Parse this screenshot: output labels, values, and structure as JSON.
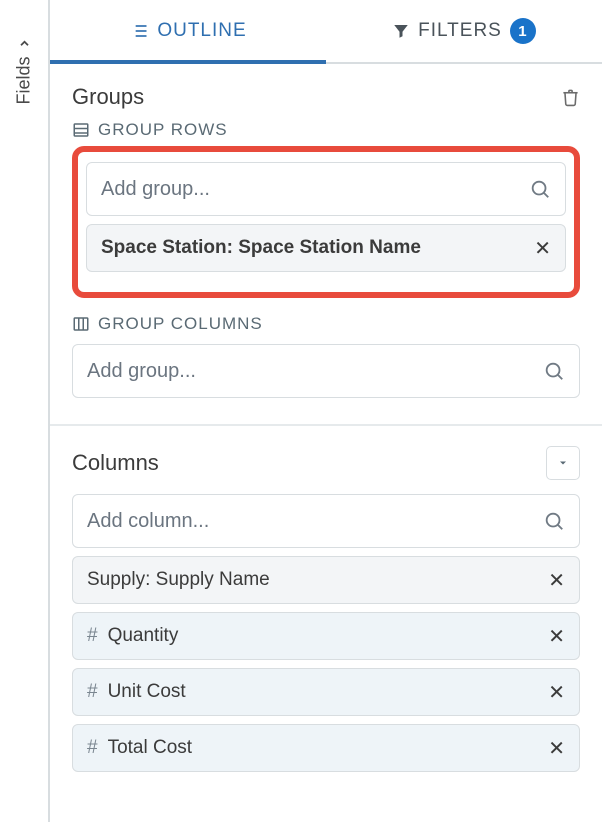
{
  "fields_tab_label": "Fields",
  "tabs": {
    "outline": "OUTLINE",
    "filters": "FILTERS",
    "filters_count": "1"
  },
  "groups": {
    "title": "Groups",
    "rows_label": "GROUP ROWS",
    "columns_label": "GROUP COLUMNS",
    "add_placeholder": "Add group...",
    "row_items": [
      {
        "label": "Space Station: Space Station Name"
      }
    ]
  },
  "columns": {
    "title": "Columns",
    "add_placeholder": "Add column...",
    "items": [
      {
        "type": "text",
        "label": "Supply: Supply Name"
      },
      {
        "type": "number",
        "label": "Quantity"
      },
      {
        "type": "number",
        "label": "Unit Cost"
      },
      {
        "type": "number",
        "label": "Total Cost"
      }
    ]
  }
}
